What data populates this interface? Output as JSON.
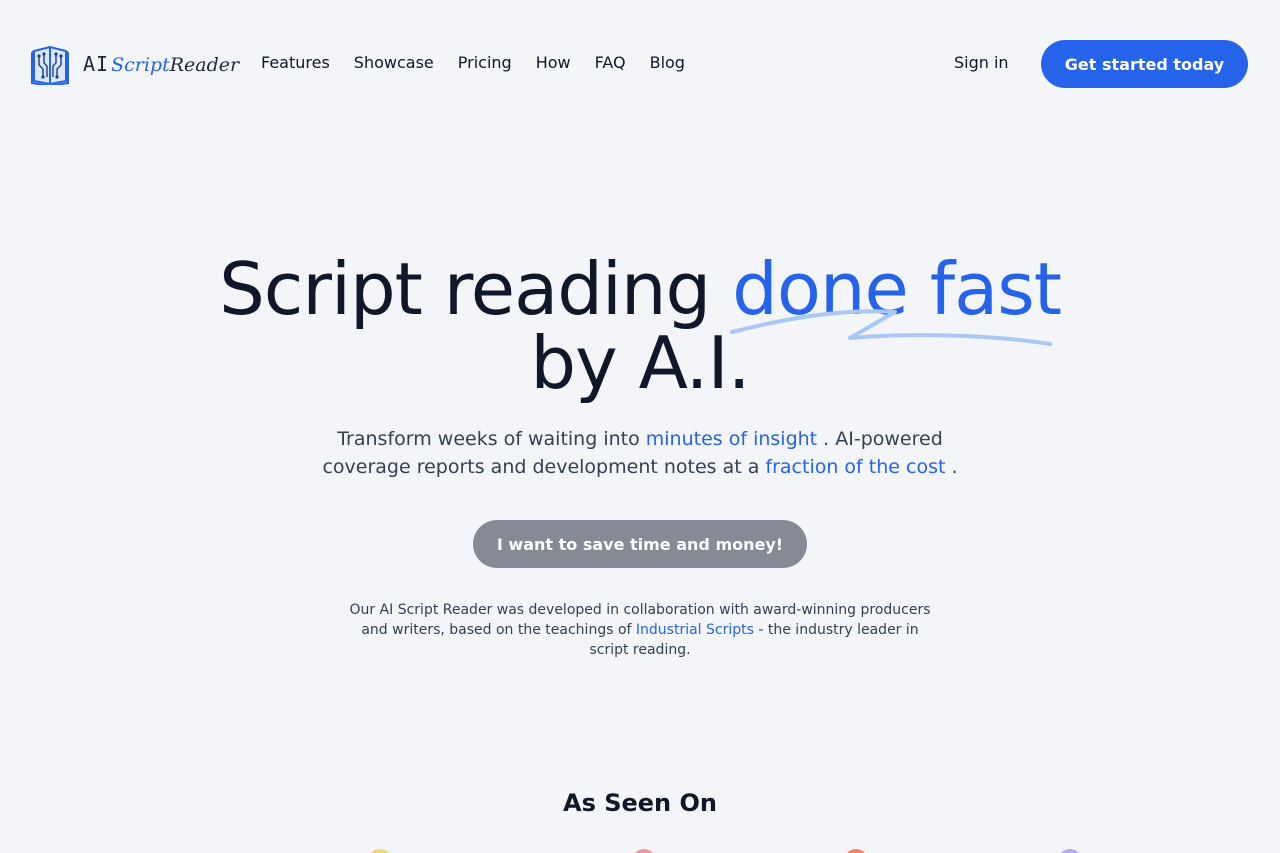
{
  "brand": {
    "ai": "AI",
    "script": "Script",
    "reader": "Reader",
    "accent_color": "#2563eb"
  },
  "nav": {
    "items": [
      "Features",
      "Showcase",
      "Pricing",
      "How",
      "FAQ",
      "Blog"
    ]
  },
  "header": {
    "signin_label": "Sign in",
    "cta_label": "Get started today"
  },
  "hero": {
    "title_part1": "Script reading ",
    "title_accent": "done fast",
    "title_part2": "by A.I.",
    "subtitle_part1": "Transform weeks of waiting into ",
    "subtitle_hl1": "minutes of insight",
    "subtitle_part2": " . AI-powered coverage reports and development notes at a ",
    "subtitle_hl2": "fraction of the cost",
    "subtitle_part3": " .",
    "cta_label": "I want to save time and money!",
    "blurb_part1": "Our AI Script Reader was developed in collaboration with award-winning producers and writers, based on the teachings of ",
    "blurb_link": "Industrial Scripts",
    "blurb_part2": " - the industry leader in script reading."
  },
  "seen_on": {
    "title": "As Seen On"
  }
}
